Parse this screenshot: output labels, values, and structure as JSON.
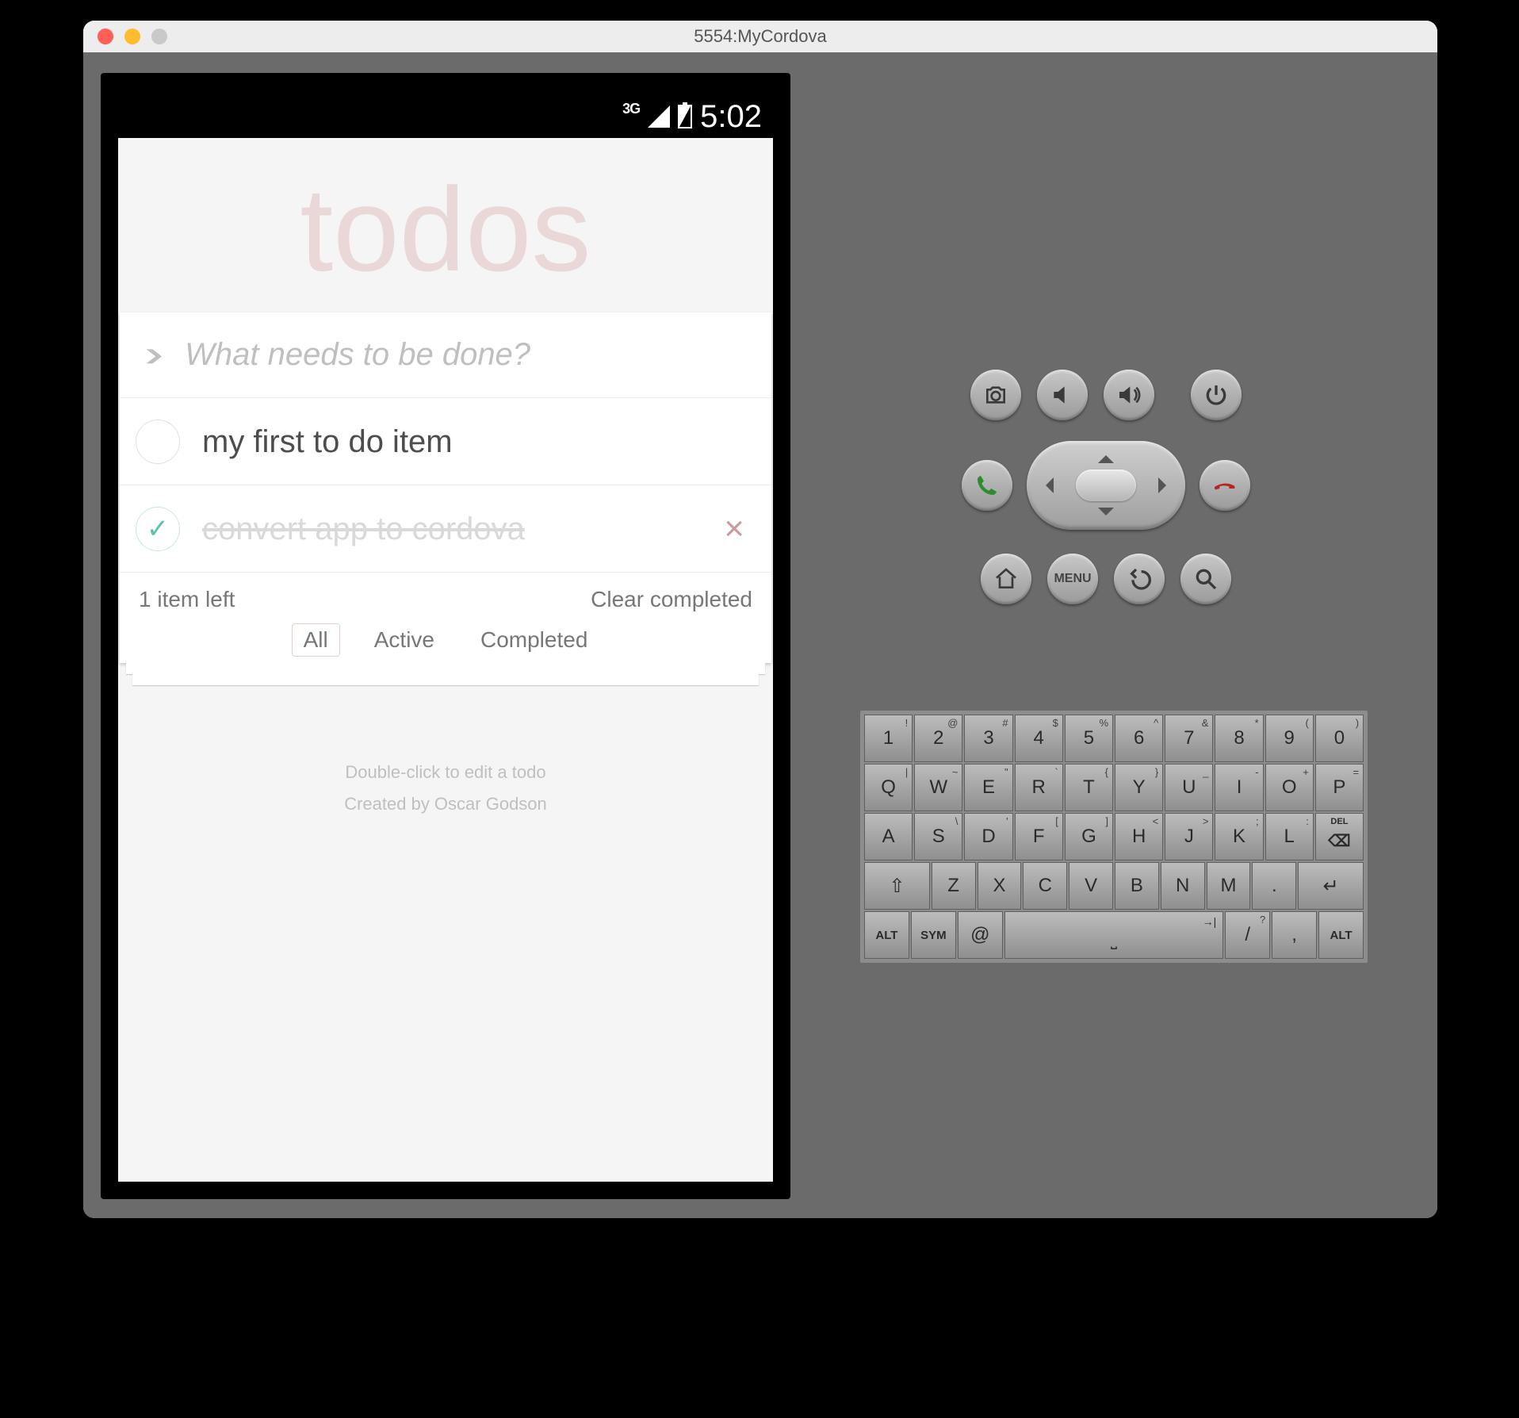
{
  "window": {
    "title": "5554:MyCordova"
  },
  "status": {
    "network": "3G",
    "time": "5:02"
  },
  "app": {
    "title": "todos",
    "placeholder": "What needs to be done?",
    "todos": [
      {
        "text": "my first to do item",
        "completed": false
      },
      {
        "text": "convert app to cordova",
        "completed": true
      }
    ],
    "count_text": "1 item left",
    "clear_text": "Clear completed",
    "filters": {
      "all": "All",
      "active": "Active",
      "completed": "Completed",
      "selected": "all"
    },
    "info1": "Double-click to edit a todo",
    "info2": "Created by Oscar Godson"
  },
  "hw_buttons": {
    "camera": "camera-icon",
    "vol_down": "volume-down-icon",
    "vol_up": "volume-up-icon",
    "power": "power-icon",
    "call": "call-icon",
    "end": "end-call-icon",
    "home": "home-icon",
    "menu": "MENU",
    "back": "back-icon",
    "search": "search-icon"
  },
  "keyboard": [
    [
      {
        "m": "1",
        "s": "!"
      },
      {
        "m": "2",
        "s": "@"
      },
      {
        "m": "3",
        "s": "#"
      },
      {
        "m": "4",
        "s": "$"
      },
      {
        "m": "5",
        "s": "%"
      },
      {
        "m": "6",
        "s": "^"
      },
      {
        "m": "7",
        "s": "&"
      },
      {
        "m": "8",
        "s": "*"
      },
      {
        "m": "9",
        "s": "("
      },
      {
        "m": "0",
        "s": ")"
      }
    ],
    [
      {
        "m": "Q",
        "s": "|"
      },
      {
        "m": "W",
        "s": "~"
      },
      {
        "m": "E",
        "s": "\""
      },
      {
        "m": "R",
        "s": "`"
      },
      {
        "m": "T",
        "s": "{"
      },
      {
        "m": "Y",
        "s": "}"
      },
      {
        "m": "U",
        "s": "_"
      },
      {
        "m": "I",
        "s": "-"
      },
      {
        "m": "O",
        "s": "+"
      },
      {
        "m": "P",
        "s": "="
      }
    ],
    [
      {
        "m": "A",
        "s": ""
      },
      {
        "m": "S",
        "s": "\\"
      },
      {
        "m": "D",
        "s": "'"
      },
      {
        "m": "F",
        "s": "["
      },
      {
        "m": "G",
        "s": "]"
      },
      {
        "m": "H",
        "s": "<"
      },
      {
        "m": "J",
        "s": ">"
      },
      {
        "m": "K",
        "s": ";"
      },
      {
        "m": "L",
        "s": ":"
      },
      {
        "m": "DEL",
        "s": "",
        "special": "del"
      }
    ],
    [
      {
        "m": "⇧",
        "s": "",
        "w": 1.5
      },
      {
        "m": "Z",
        "s": ""
      },
      {
        "m": "X",
        "s": ""
      },
      {
        "m": "C",
        "s": ""
      },
      {
        "m": "V",
        "s": ""
      },
      {
        "m": "B",
        "s": ""
      },
      {
        "m": "N",
        "s": ""
      },
      {
        "m": "M",
        "s": ""
      },
      {
        "m": ".",
        "s": ""
      },
      {
        "m": "↵",
        "s": "",
        "w": 1.5
      }
    ],
    [
      {
        "m": "ALT",
        "s": "",
        "small": true
      },
      {
        "m": "SYM",
        "s": "",
        "small": true
      },
      {
        "m": "@",
        "s": ""
      },
      {
        "m": "",
        "s": "→|",
        "space": true
      },
      {
        "m": "/",
        "s": "?"
      },
      {
        "m": ",",
        "s": ""
      },
      {
        "m": "ALT",
        "s": "",
        "small": true
      }
    ]
  ]
}
